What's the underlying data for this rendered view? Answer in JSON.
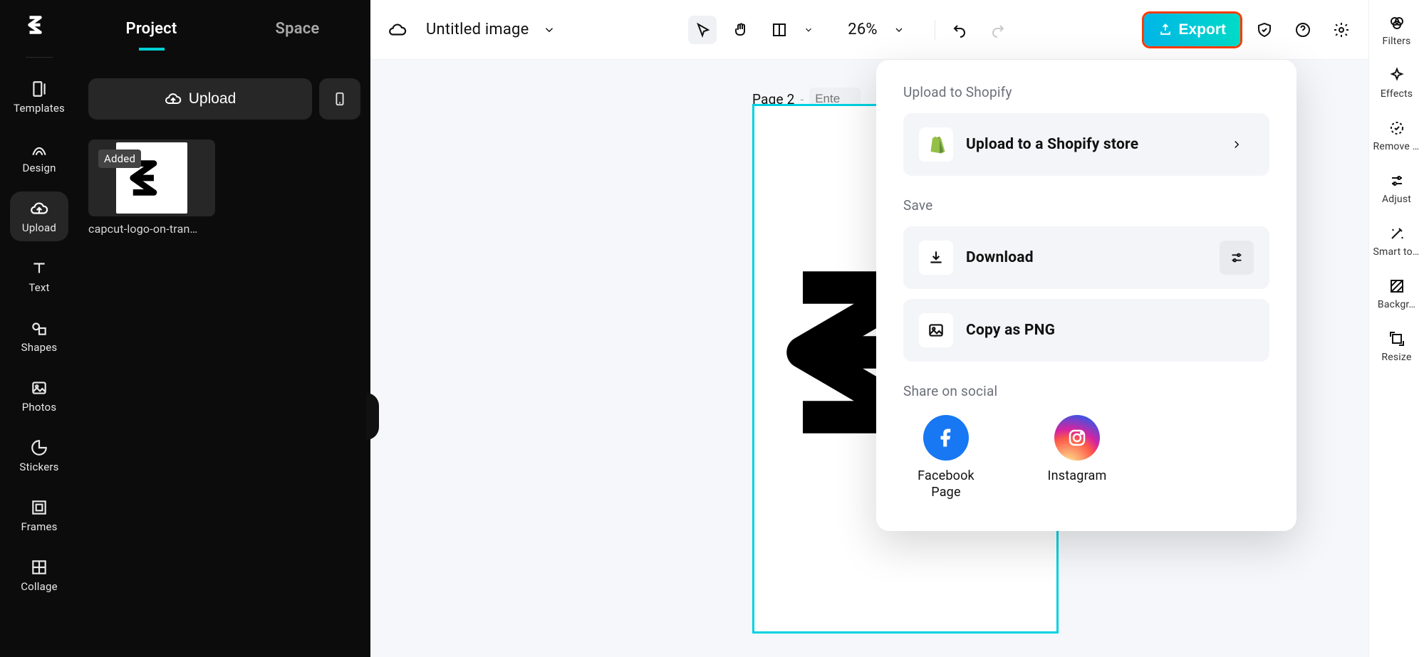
{
  "app": {
    "logo_name": "capcut"
  },
  "panel": {
    "tabs": {
      "project": "Project",
      "space": "Space"
    },
    "upload_button": "Upload",
    "asset": {
      "badge": "Added",
      "name": "capcut-logo-on-tran…"
    }
  },
  "left_rail": {
    "templates": "Templates",
    "design": "Design",
    "upload": "Upload",
    "text": "Text",
    "shapes": "Shapes",
    "photos": "Photos",
    "stickers": "Stickers",
    "frames": "Frames",
    "collage": "Collage"
  },
  "toolbar": {
    "title": "Untitled image",
    "zoom": "26%",
    "export": "Export"
  },
  "page": {
    "label": "Page 2",
    "dash": "-",
    "placeholder": "Ente"
  },
  "export_popover": {
    "upload_title": "Upload to Shopify",
    "shopify": "Upload to a Shopify store",
    "save_title": "Save",
    "download": "Download",
    "copy_png": "Copy as PNG",
    "share_title": "Share on social",
    "facebook": "Facebook Page",
    "instagram": "Instagram"
  },
  "right_rail": {
    "filters": "Filters",
    "effects": "Effects",
    "remove_bg": "Remove backgr…",
    "adjust": "Adjust",
    "smart_tools": "Smart tools",
    "background": "Backgr…",
    "resize": "Resize"
  },
  "colors": {
    "export_outline": "#ff3a00",
    "accent": "#00d1e0",
    "facebook": "#1877f2"
  }
}
